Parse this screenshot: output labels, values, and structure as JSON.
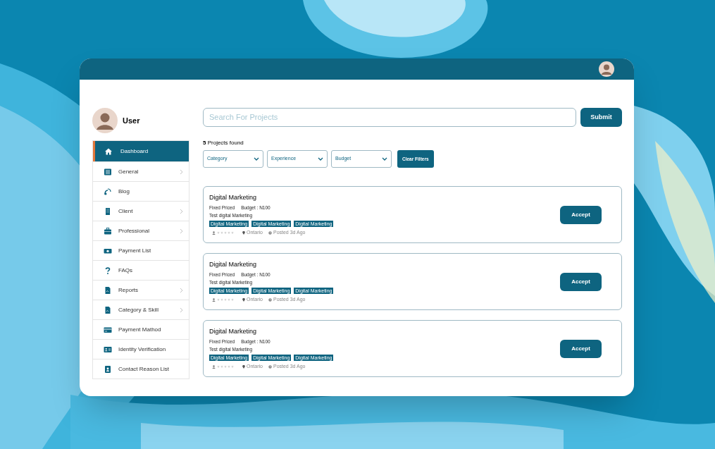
{
  "user": {
    "name": "User"
  },
  "sidebar": {
    "items": [
      {
        "label": "Dashboard",
        "selected": true,
        "has_submenu": false
      },
      {
        "label": "General",
        "selected": false,
        "has_submenu": true
      },
      {
        "label": "Blog",
        "selected": false,
        "has_submenu": false
      },
      {
        "label": "Client",
        "selected": false,
        "has_submenu": true
      },
      {
        "label": "Professional",
        "selected": false,
        "has_submenu": true
      },
      {
        "label": "Payment List",
        "selected": false,
        "has_submenu": false
      },
      {
        "label": "FAQs",
        "selected": false,
        "has_submenu": false
      },
      {
        "label": "Reports",
        "selected": false,
        "has_submenu": true
      },
      {
        "label": "Category & Skill",
        "selected": false,
        "has_submenu": true
      },
      {
        "label": "Payment Mathod",
        "selected": false,
        "has_submenu": false
      },
      {
        "label": "Identity Verification",
        "selected": false,
        "has_submenu": false
      },
      {
        "label": "Contact Reason List",
        "selected": false,
        "has_submenu": false
      }
    ]
  },
  "search": {
    "placeholder": "Search For Projects",
    "button": "Submit"
  },
  "results_count": "**5** Projects found",
  "filters": [
    "Category",
    "Experience",
    "Budget"
  ],
  "clear_button": "Clear Filters",
  "projects": [
    {
      "title": "Digital Marketing",
      "pricing": "Fixed Priced",
      "budget": "Budget : N100",
      "description": "Test digital Marketing",
      "tags": [
        "Digital Marketing",
        "Digital Marketing",
        "Digital Marketing"
      ],
      "stars": 0,
      "location": "Ontario",
      "posted": "Posted 3d Ago",
      "button": "Accept"
    },
    {
      "title": "Digital Marketing",
      "pricing": "Fixed Priced",
      "budget": "Budget : N100",
      "description": "Test digital Marketing",
      "tags": [
        "Digital Marketing",
        "Digital Marketing",
        "Digital Marketing"
      ],
      "stars": 0,
      "location": "Ontario",
      "posted": "Posted 3d Ago",
      "button": "Accept"
    },
    {
      "title": "Digital Marketing",
      "pricing": "Fixed Priced",
      "budget": "Budget : N100",
      "description": "Test digital Marketing",
      "tags": [
        "Digital Marketing",
        "Digital Marketing",
        "Digital Marketing"
      ],
      "stars": 0,
      "location": "Ontario",
      "posted": "Posted 3d Ago",
      "button": "Accept"
    }
  ]
}
